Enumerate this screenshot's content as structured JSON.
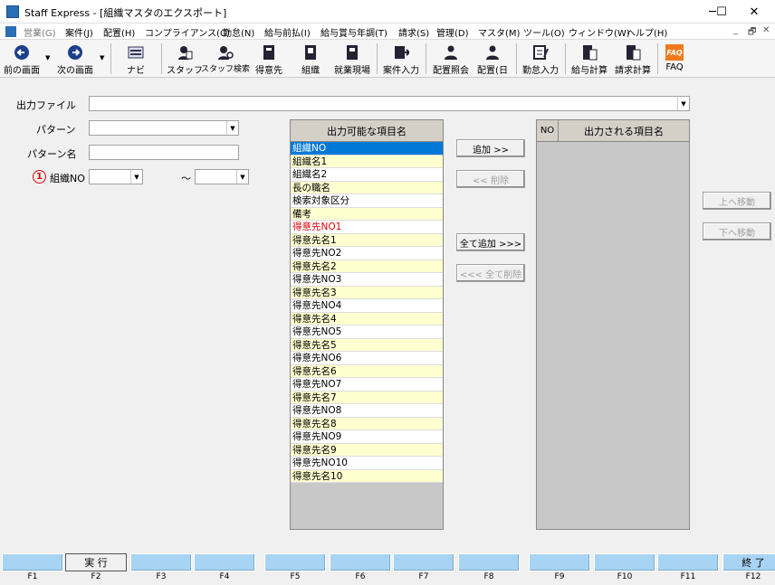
{
  "window": {
    "title": "Staff Express - [組織マスタのエクスポート]",
    "minimize": "─",
    "maximize": "☐",
    "close": "✕"
  },
  "menu": [
    "営業(G)",
    "案件(J)",
    "配置(H)",
    "コンプライアンス(C)",
    "勤怠(N)",
    "給与前払(I)",
    "給与賞与年調(T)",
    "請求(S)",
    "管理(D)",
    "マスタ(M)",
    "ツール(O)",
    "ウィンドウ(W)",
    "ヘルプ(H)"
  ],
  "mdi_controls": [
    "_",
    "🗗",
    "✕"
  ],
  "toolbar": [
    {
      "label": "前の画面",
      "icon": "back-arrow-icon"
    },
    {
      "label": "次の画面",
      "icon": "forward-arrow-icon"
    },
    {
      "label": "ナビ",
      "icon": "navi-icon"
    },
    {
      "label": "スタッフ",
      "icon": "staff-icon"
    },
    {
      "label": "スタッフ検索",
      "icon": "staff-search-icon"
    },
    {
      "label": "得意先",
      "icon": "customer-icon"
    },
    {
      "label": "組織",
      "icon": "organization-icon"
    },
    {
      "label": "就業現場",
      "icon": "worksite-icon"
    },
    {
      "label": "案件入力",
      "icon": "case-input-icon"
    },
    {
      "label": "配置照会",
      "icon": "placement-inquiry-icon"
    },
    {
      "label": "配置(日",
      "icon": "placement-daily-icon"
    },
    {
      "label": "勤怠入力",
      "icon": "attendance-input-icon"
    },
    {
      "label": "給与計算",
      "icon": "payroll-icon"
    },
    {
      "label": "請求計算",
      "icon": "billing-icon"
    },
    {
      "label": "FAQ",
      "icon": "faq-icon"
    }
  ],
  "form": {
    "output_file_label": "出力ファイル",
    "output_file_value": "",
    "pattern_label": "パターン",
    "pattern_value": "",
    "pattern_name_label": "パターン名",
    "pattern_name_value": "",
    "marker": "①",
    "org_no_label": "組織NO",
    "org_no_from": "",
    "tilde": "～",
    "org_no_to": ""
  },
  "available_list": {
    "header": "出力可能な項目名",
    "items": [
      "組織NO",
      "組織名1",
      "組織名2",
      "長の職名",
      "検索対象区分",
      "備考",
      "得意先NO1",
      "得意先名1",
      "得意先NO2",
      "得意先名2",
      "得意先NO3",
      "得意先名3",
      "得意先NO4",
      "得意先名4",
      "得意先NO5",
      "得意先名5",
      "得意先NO6",
      "得意先名6",
      "得意先NO7",
      "得意先名7",
      "得意先NO8",
      "得意先名8",
      "得意先NO9",
      "得意先名9",
      "得意先NO10",
      "得意先名10"
    ]
  },
  "buttons": {
    "add": "追加 >>",
    "remove": "<< 削除",
    "add_all": "全て追加 >>>",
    "remove_all": "<<< 全て削除",
    "move_up": "上へ移動",
    "move_down": "下へ移動"
  },
  "output_list": {
    "no_header": "NO",
    "header": "出力される項目名"
  },
  "fkeys": [
    {
      "key": "F1",
      "label": ""
    },
    {
      "key": "F2",
      "label": "実 行"
    },
    {
      "key": "F3",
      "label": ""
    },
    {
      "key": "F4",
      "label": ""
    },
    {
      "key": "F5",
      "label": ""
    },
    {
      "key": "F6",
      "label": ""
    },
    {
      "key": "F7",
      "label": ""
    },
    {
      "key": "F8",
      "label": ""
    },
    {
      "key": "F9",
      "label": ""
    },
    {
      "key": "F10",
      "label": ""
    },
    {
      "key": "F11",
      "label": ""
    },
    {
      "key": "F12",
      "label": "終 了"
    }
  ],
  "colors": {
    "fkey_bg": "#a8d4f4",
    "selection": "#0078d7",
    "row_alt": "#ffffd0",
    "highlight_red": "#e00000",
    "marker_red": "#e00000"
  }
}
